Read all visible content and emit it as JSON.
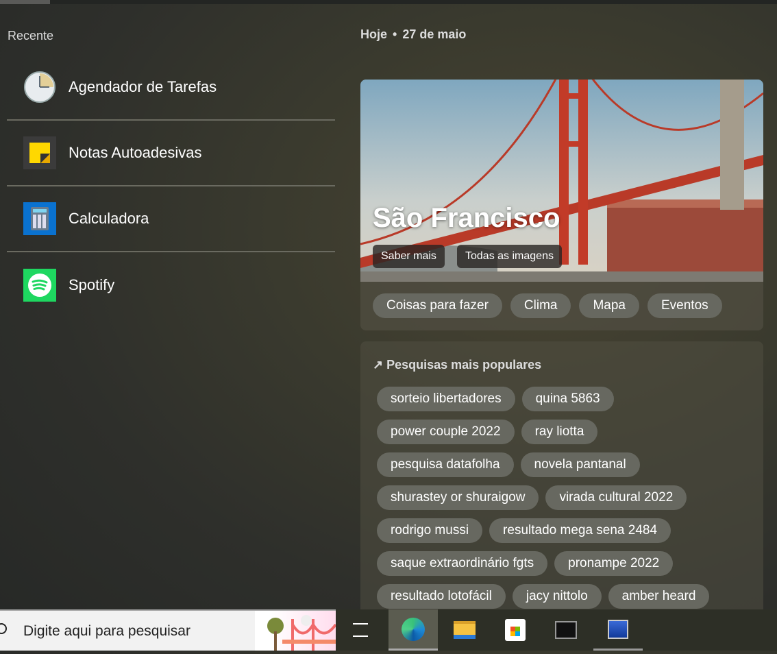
{
  "recent": {
    "title": "Recente",
    "apps": [
      {
        "label": "Agendador de Tarefas",
        "icon": "clock-icon"
      },
      {
        "label": "Notas Autoadesivas",
        "icon": "sticky-notes-icon"
      },
      {
        "label": "Calculadora",
        "icon": "calculator-icon"
      },
      {
        "label": "Spotify",
        "icon": "spotify-icon"
      }
    ]
  },
  "date": {
    "today": "Hoje",
    "sep": "•",
    "date": "27 de maio"
  },
  "hero": {
    "title": "São Francisco",
    "learn_more": "Saber mais",
    "all_images": "Todas as imagens",
    "categories": [
      "Coisas para fazer",
      "Clima",
      "Mapa",
      "Eventos"
    ]
  },
  "popular": {
    "title": "Pesquisas mais populares",
    "items": [
      "sorteio libertadores",
      "quina 5863",
      "power couple 2022",
      "ray liotta",
      "pesquisa datafolha",
      "novela pantanal",
      "shurastey or shuraigow",
      "virada cultural 2022",
      "rodrigo mussi",
      "resultado mega sena 2484",
      "saque extraordinário fgts",
      "pronampe 2022",
      "resultado lotofácil",
      "jacy nittolo",
      "amber heard"
    ]
  },
  "taskbar": {
    "search_placeholder": "Digite aqui para pesquisar"
  }
}
